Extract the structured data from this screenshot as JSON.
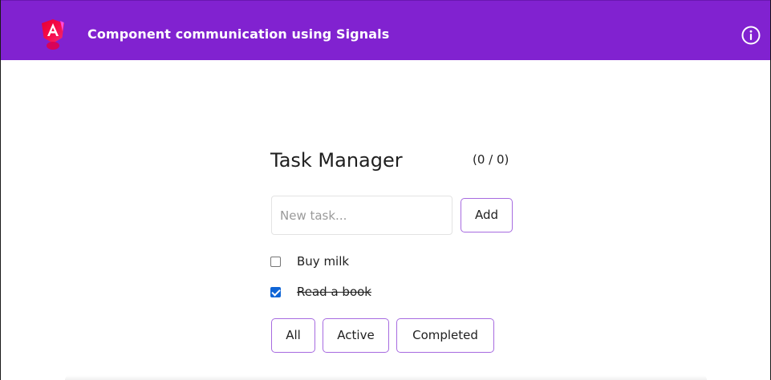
{
  "header": {
    "title": "Component communication using Signals",
    "logo_icon": "angular-logo-icon",
    "info_icon": "info-icon",
    "brand_color": "#8122d0"
  },
  "task_manager": {
    "title": "Task Manager",
    "counter": "(0 / 0)",
    "input": {
      "placeholder": "New task...",
      "value": ""
    },
    "add_label": "Add",
    "tasks": [
      {
        "label": "Buy milk",
        "completed": false
      },
      {
        "label": "Read a book",
        "completed": true
      }
    ],
    "filters": [
      {
        "label": "All"
      },
      {
        "label": "Active"
      },
      {
        "label": "Completed"
      }
    ],
    "accent_border": "#a76be0",
    "checkbox_color": "#0f65d6"
  }
}
